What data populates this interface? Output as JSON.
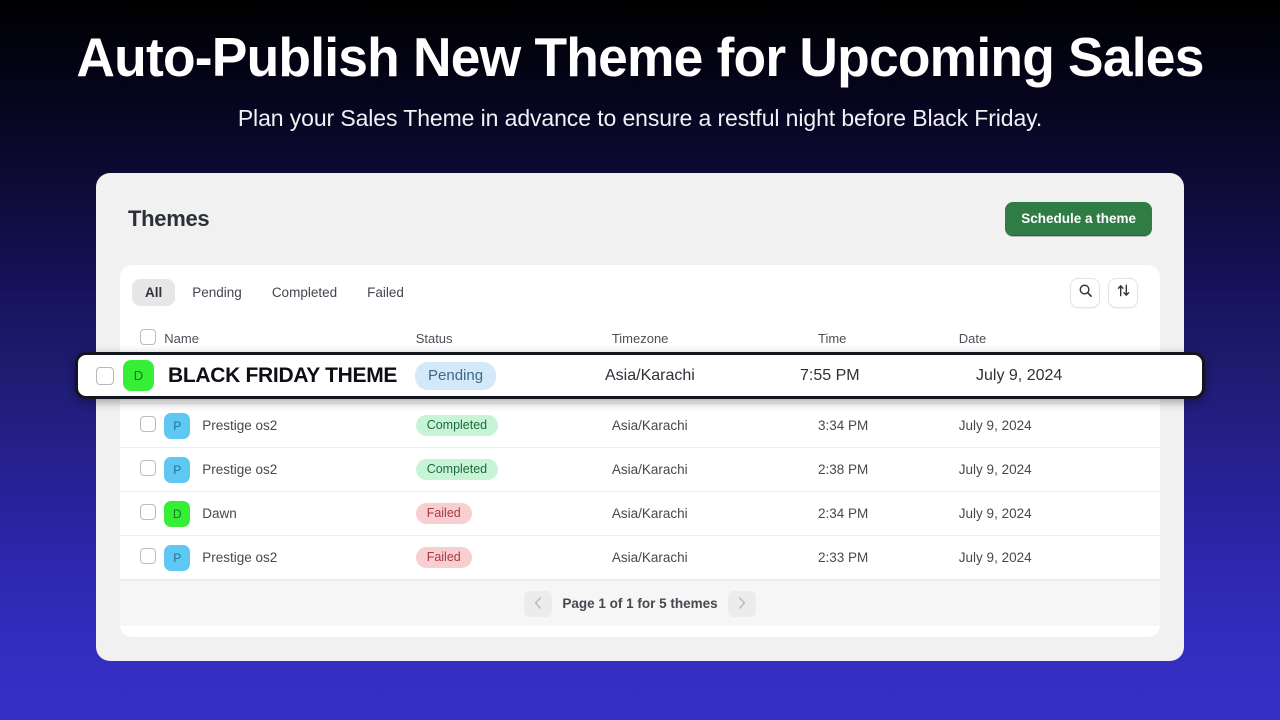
{
  "hero": {
    "title": "Auto-Publish New Theme for Upcoming Sales",
    "subtitle": "Plan your Sales Theme in advance to ensure a restful night before Black Friday."
  },
  "panel": {
    "title": "Themes",
    "schedule_button": "Schedule a theme",
    "search_icon": "search-icon",
    "sort_icon": "sort-arrows-icon"
  },
  "tabs": [
    {
      "label": "All",
      "active": true
    },
    {
      "label": "Pending",
      "active": false
    },
    {
      "label": "Completed",
      "active": false
    },
    {
      "label": "Failed",
      "active": false
    }
  ],
  "table": {
    "columns": [
      "Name",
      "Status",
      "Timezone",
      "Time",
      "Date"
    ],
    "rows": [
      {
        "avatar_letter": "P",
        "avatar_color": "#5ec8f2",
        "name": "Prestige os2",
        "status": "Completed",
        "timezone": "Asia/Karachi",
        "time": "3:34 PM",
        "date": "July 9, 2024"
      },
      {
        "avatar_letter": "P",
        "avatar_color": "#5ec8f2",
        "name": "Prestige os2",
        "status": "Completed",
        "timezone": "Asia/Karachi",
        "time": "2:38 PM",
        "date": "July 9, 2024"
      },
      {
        "avatar_letter": "D",
        "avatar_color": "#37ee37",
        "name": "Dawn",
        "status": "Failed",
        "timezone": "Asia/Karachi",
        "time": "2:34 PM",
        "date": "July 9, 2024"
      },
      {
        "avatar_letter": "P",
        "avatar_color": "#5ec8f2",
        "name": "Prestige os2",
        "status": "Failed",
        "timezone": "Asia/Karachi",
        "time": "2:33 PM",
        "date": "July 9, 2024"
      }
    ]
  },
  "highlighted_row": {
    "avatar_letter": "D",
    "avatar_color": "#37ee37",
    "name": "BLACK FRIDAY THEME",
    "status": "Pending",
    "timezone": "Asia/Karachi",
    "time": "7:55 PM",
    "date": "July 9, 2024"
  },
  "pagination": {
    "prev_icon": "chevron-left-icon",
    "next_icon": "chevron-right-icon",
    "text": "Page 1 of 1 for 5 themes"
  },
  "colors": {
    "accent_green": "#2f7d45",
    "bg_top": "#000000",
    "bg_bottom": "#3730c8",
    "badge_pending_bg": "#d3e8f8",
    "badge_completed_bg": "#c7f4d6",
    "badge_failed_bg": "#f8ced1"
  }
}
